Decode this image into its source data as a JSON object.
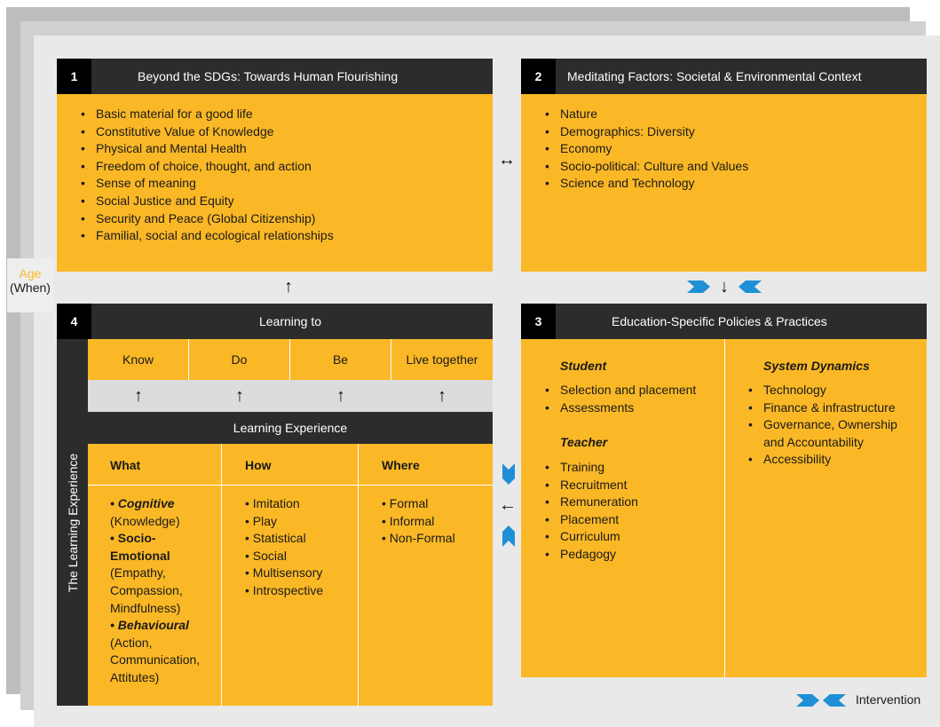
{
  "side": {
    "age": "Age",
    "when": "(When)"
  },
  "vertical_label": "The Learning Experience",
  "panel1": {
    "number": "1",
    "title": "Beyond the SDGs: Towards Human Flourishing",
    "items": [
      "Basic material for a good life",
      "Constitutive Value of Knowledge",
      "Physical and Mental Health",
      "Freedom of choice, thought, and action",
      "Sense of meaning",
      "Social Justice and Equity",
      "Security and Peace (Global Citizenship)",
      "Familial, social and ecological relationships"
    ]
  },
  "panel2": {
    "number": "2",
    "title": "Meditating Factors: Societal & Environmental Context",
    "items": [
      "Nature",
      "Demographics: Diversity",
      "Economy",
      "Socio-political: Culture and Values",
      "Science and Technology"
    ]
  },
  "panel3": {
    "number": "3",
    "title": "Education-Specific Policies & Practices",
    "student": {
      "heading": "Student",
      "items": [
        "Selection and placement",
        "Assessments"
      ]
    },
    "teacher": {
      "heading": "Teacher",
      "items": [
        "Training",
        "Recruitment",
        "Remuneration",
        "Placement",
        "Curriculum",
        "Pedagogy"
      ]
    },
    "system": {
      "heading": "System Dynamics",
      "items": [
        "Technology",
        "Finance & infrastructure",
        "Governance, Ownership",
        "and Accountability",
        "Accessibility"
      ]
    }
  },
  "panel4": {
    "number": "4",
    "title": "Learning to",
    "pillars": [
      "Know",
      "Do",
      "Be",
      "Live together"
    ],
    "experience_title": "Learning Experience",
    "columns": {
      "what": {
        "heading": "What",
        "lines": [
          "Cognitive",
          "(Knowledge)",
          "Socio-",
          "Emotional",
          "(Empathy,",
          "Compassion,",
          "Mindfulness)",
          "Behavioural",
          "(Action,",
          "Communication,",
          "Attitutes)"
        ]
      },
      "how": {
        "heading": "How",
        "items": [
          "Imitation",
          "Play",
          "Statistical",
          "Social",
          "Multisensory",
          "Introspective"
        ]
      },
      "where": {
        "heading": "Where",
        "items": [
          "Formal",
          "Informal",
          "Non-Formal"
        ]
      }
    }
  },
  "arrows": {
    "bidirectional": "↔",
    "up": "↑",
    "down": "↓",
    "left": "←"
  },
  "legend": {
    "label": "Intervention"
  },
  "colors": {
    "panel": "#fbb826",
    "header": "#2c2c2c",
    "number": "#000000",
    "chevron": "#1f8fd6"
  }
}
